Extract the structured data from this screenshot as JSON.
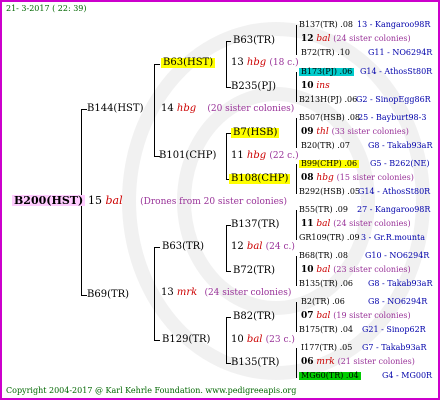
{
  "header": {
    "date": "21-  3-2017 ( 22: 39)"
  },
  "footer": {
    "copyright": "Copyright 2004-2017 @ Karl Kehrle Foundation.   www.pedigreeapis.org"
  },
  "root": {
    "id": "B200(HST)",
    "num": "15",
    "name": "bal",
    "note": "(Drones from 20 sister colonies)"
  },
  "gen1": {
    "top": {
      "id": "B144(HST)",
      "num": "14",
      "name": "hbg",
      "note": "(20 sister colonies)"
    },
    "bot": {
      "id": "B69(TR)",
      "num": "13",
      "name": "mrk",
      "note": "(24 sister colonies)"
    }
  },
  "gen2": {
    "a": {
      "id": "B63(HST)",
      "num": "13",
      "name": "hbg",
      "note": "(18 c.)"
    },
    "b": {
      "id": "B101(CHP)",
      "num": "11",
      "name": "hbg",
      "note": "(22 c.)"
    },
    "c": {
      "id": "B63(TR)",
      "num": "12",
      "name": "bal",
      "note": "(24 c.)"
    },
    "d": {
      "id": "B129(TR)",
      "num": "10",
      "name": "bal",
      "note": "(23 c.)"
    }
  },
  "gen3": {
    "a1": "B63(TR)",
    "a2": "B235(PJ)",
    "b1": "B7(HSB)",
    "b2": "B108(CHP)",
    "c1": "B137(TR)",
    "c2": "B72(TR)",
    "d1": "B82(TR)",
    "d2": "B135(TR)"
  },
  "gen4": [
    {
      "top_id": "B137(TR) .08",
      "top_info": "13 - Kangaroo98R",
      "num": "12",
      "name": "bal",
      "note": "(24 sister colonies)",
      "bot_id": "B72(TR) .10",
      "bot_info": "G11 - NO6294R"
    },
    {
      "top_id": "B173(PJ) .06",
      "top_info": "G14 - AthosSt80R",
      "num": "10",
      "name": "ins",
      "note": "",
      "bot_id": "B213H(PJ) .06",
      "bot_info": "G2 - SinopEgg86R"
    },
    {
      "top_id": "B507(HSB) .08",
      "top_info": "25 - Bayburt98-3",
      "num": "09",
      "name": "thl",
      "note": "(33 sister colonies)",
      "bot_id": "B20(TR) .07",
      "bot_info": "G8 - Takab93aR"
    },
    {
      "top_id": "B99(CHP) .06",
      "top_info": "G5 - B262(NE)",
      "num": "08",
      "name": "hbg",
      "note": "(15 sister colonies)",
      "bot_id": "B292(HSB) .05",
      "bot_info": "G14 - AthosSt80R"
    },
    {
      "top_id": "B55(TR) .09",
      "top_info": "27 - Kangaroo98R",
      "num": "11",
      "name": "bal",
      "note": "(24 sister colonies)",
      "bot_id": "GR109(TR) .09",
      "bot_info": "3 - Gr.R.mounta"
    },
    {
      "top_id": "B68(TR) .08",
      "top_info": "G10 - NO6294R",
      "num": "10",
      "name": "bal",
      "note": "(23 sister colonies)",
      "bot_id": "B135(TR) .06",
      "bot_info": "G8 - Takab93aR"
    },
    {
      "top_id": "B2(TR) .06",
      "top_info": "G8 - NO6294R",
      "num": "07",
      "name": "bal",
      "note": "(19 sister colonies)",
      "bot_id": "B175(TR) .04",
      "bot_info": "G21 - Sinop62R"
    },
    {
      "top_id": "I177(TR) .05",
      "top_info": "G7 - Takab93aR",
      "num": "06",
      "name": "mrk",
      "note": "(21 sister colonies)",
      "bot_id": "MG60(TR) .04",
      "bot_info": "G4 - MG00R"
    }
  ]
}
